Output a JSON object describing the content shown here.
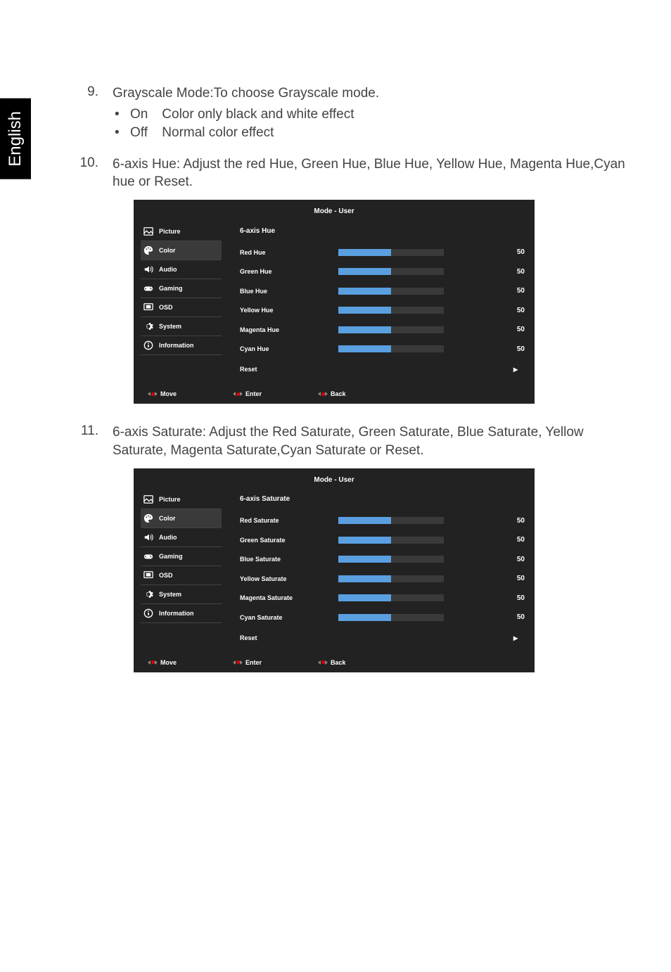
{
  "langTab": "English",
  "items": [
    {
      "num": "9.",
      "text": "Grayscale Mode:To choose Grayscale mode.",
      "bullets": [
        {
          "opt": "On",
          "desc": "Color only black and white effect"
        },
        {
          "opt": "Off",
          "desc": "Normal color effect"
        }
      ]
    },
    {
      "num": "10.",
      "text": "6-axis Hue: Adjust the red Hue, Green Hue, Blue Hue, Yellow Hue, Magenta Hue,Cyan hue or Reset.",
      "osd": {
        "title": "Mode - User",
        "nav": [
          {
            "label": "Picture",
            "icon": "picture"
          },
          {
            "label": "Color",
            "icon": "color",
            "active": true
          },
          {
            "label": "Audio",
            "icon": "audio"
          },
          {
            "label": "Gaming",
            "icon": "gaming"
          },
          {
            "label": "OSD",
            "icon": "osd"
          },
          {
            "label": "System",
            "icon": "system"
          },
          {
            "label": "Information",
            "icon": "info"
          }
        ],
        "settingsTitle": "6-axis Hue",
        "rows": [
          {
            "label": "Red Hue",
            "val": "50",
            "fill": 50
          },
          {
            "label": "Green Hue",
            "val": "50",
            "fill": 50
          },
          {
            "label": "Blue Hue",
            "val": "50",
            "fill": 50
          },
          {
            "label": "Yellow Hue",
            "val": "50",
            "fill": 50
          },
          {
            "label": "Magenta Hue",
            "val": "50",
            "fill": 50
          },
          {
            "label": "Cyan Hue",
            "val": "50",
            "fill": 50
          }
        ],
        "reset": "Reset",
        "footer": [
          "Move",
          "Enter",
          "Back"
        ]
      }
    },
    {
      "num": "11.",
      "text": "6-axis Saturate: Adjust the Red Saturate, Green Saturate, Blue Saturate, Yellow Saturate, Magenta Saturate,Cyan Saturate or Reset.",
      "osd": {
        "title": "Mode - User",
        "nav": [
          {
            "label": "Picture",
            "icon": "picture"
          },
          {
            "label": "Color",
            "icon": "color",
            "active": true
          },
          {
            "label": "Audio",
            "icon": "audio"
          },
          {
            "label": "Gaming",
            "icon": "gaming"
          },
          {
            "label": "OSD",
            "icon": "osd"
          },
          {
            "label": "System",
            "icon": "system"
          },
          {
            "label": "Information",
            "icon": "info"
          }
        ],
        "settingsTitle": "6-axis Saturate",
        "rows": [
          {
            "label": "Red Saturate",
            "val": "50",
            "fill": 50
          },
          {
            "label": "Green Saturate",
            "val": "50",
            "fill": 50
          },
          {
            "label": "Blue Saturate",
            "val": "50",
            "fill": 50
          },
          {
            "label": "Yellow Saturate",
            "val": "50",
            "fill": 50
          },
          {
            "label": "Magenta Saturate",
            "val": "50",
            "fill": 50
          },
          {
            "label": "Cyan Saturate",
            "val": "50",
            "fill": 50
          }
        ],
        "reset": "Reset",
        "footer": [
          "Move",
          "Enter",
          "Back"
        ]
      }
    }
  ]
}
